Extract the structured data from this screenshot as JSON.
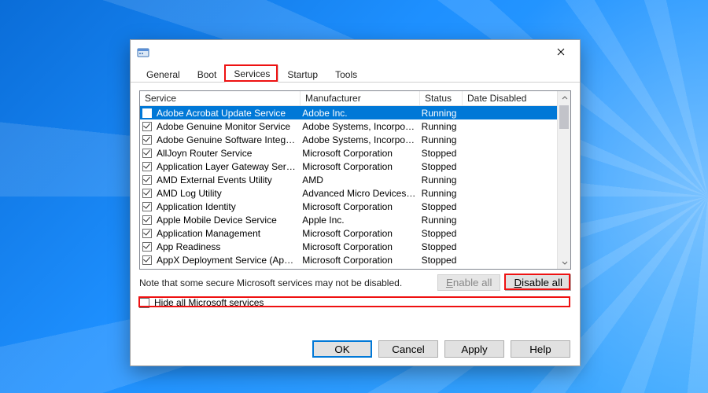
{
  "tabs": [
    {
      "label": "General",
      "active": false
    },
    {
      "label": "Boot",
      "active": false
    },
    {
      "label": "Services",
      "active": true
    },
    {
      "label": "Startup",
      "active": false
    },
    {
      "label": "Tools",
      "active": false
    }
  ],
  "columns": {
    "service": "Service",
    "manufacturer": "Manufacturer",
    "status": "Status",
    "date": "Date Disabled"
  },
  "col_widths": {
    "service": 186,
    "manufacturer": 152,
    "status": 54,
    "date": 122
  },
  "rows": [
    {
      "checked": true,
      "selected": true,
      "service": "Adobe Acrobat Update Service",
      "manufacturer": "Adobe Inc.",
      "status": "Running",
      "date": ""
    },
    {
      "checked": true,
      "selected": false,
      "service": "Adobe Genuine Monitor Service",
      "manufacturer": "Adobe Systems, Incorpora...",
      "status": "Running",
      "date": ""
    },
    {
      "checked": true,
      "selected": false,
      "service": "Adobe Genuine Software Integri...",
      "manufacturer": "Adobe Systems, Incorpora...",
      "status": "Running",
      "date": ""
    },
    {
      "checked": true,
      "selected": false,
      "service": "AllJoyn Router Service",
      "manufacturer": "Microsoft Corporation",
      "status": "Stopped",
      "date": ""
    },
    {
      "checked": true,
      "selected": false,
      "service": "Application Layer Gateway Service",
      "manufacturer": "Microsoft Corporation",
      "status": "Stopped",
      "date": ""
    },
    {
      "checked": true,
      "selected": false,
      "service": "AMD External Events Utility",
      "manufacturer": "AMD",
      "status": "Running",
      "date": ""
    },
    {
      "checked": true,
      "selected": false,
      "service": "AMD Log Utility",
      "manufacturer": "Advanced Micro Devices, I...",
      "status": "Running",
      "date": ""
    },
    {
      "checked": true,
      "selected": false,
      "service": "Application Identity",
      "manufacturer": "Microsoft Corporation",
      "status": "Stopped",
      "date": ""
    },
    {
      "checked": true,
      "selected": false,
      "service": "Apple Mobile Device Service",
      "manufacturer": "Apple Inc.",
      "status": "Running",
      "date": ""
    },
    {
      "checked": true,
      "selected": false,
      "service": "Application Management",
      "manufacturer": "Microsoft Corporation",
      "status": "Stopped",
      "date": ""
    },
    {
      "checked": true,
      "selected": false,
      "service": "App Readiness",
      "manufacturer": "Microsoft Corporation",
      "status": "Stopped",
      "date": ""
    },
    {
      "checked": true,
      "selected": false,
      "service": "AppX Deployment Service (AppX...",
      "manufacturer": "Microsoft Corporation",
      "status": "Stopped",
      "date": ""
    }
  ],
  "note": "Note that some secure Microsoft services may not be disabled.",
  "buttons": {
    "enable_all": "Enable all",
    "disable_all": "Disable all",
    "ok": "OK",
    "cancel": "Cancel",
    "apply": "Apply",
    "help": "Help"
  },
  "hide_label_pre": "H",
  "hide_label_rest": "ide all Microsoft services",
  "underline": {
    "enable": "E",
    "enable_rest": "nable all",
    "disable": "D",
    "disable_rest": "isable all"
  }
}
